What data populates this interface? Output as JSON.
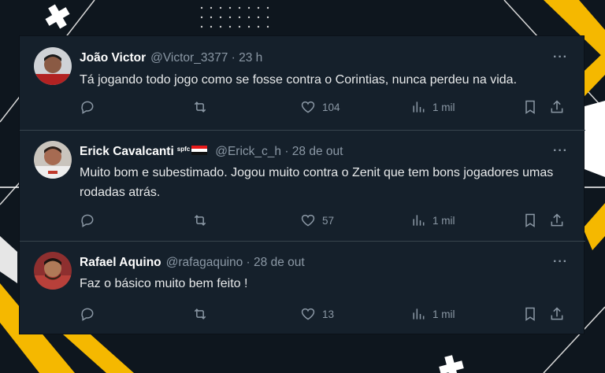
{
  "tweets": [
    {
      "name": "João Victor",
      "handle": "@Victor_3377 · 23 h",
      "badge": "",
      "text": "Tá jogando todo jogo como se fosse contra o Corintias, nunca perdeu na vida.",
      "likes": "104",
      "views": "1 mil"
    },
    {
      "name": "Erick Cavalcanti",
      "handle": "@Erick_c_h · 28 de out",
      "badge": "spfc",
      "text": "Muito bom e subestimado. Jogou muito contra o Zenit que tem bons jogadores umas rodadas atrás.",
      "likes": "57",
      "views": "1 mil"
    },
    {
      "name": "Rafael Aquino",
      "handle": "@rafagaquino · 28 de out",
      "badge": "",
      "text": "Faz o básico muito bem feito !",
      "likes": "13",
      "views": "1 mil"
    }
  ],
  "more_label": "···",
  "colors": {
    "background": "#15202b",
    "text": "#e7e9ea",
    "muted": "#8b98a5",
    "accent_yellow": "#f5b800"
  },
  "icons": [
    "reply-icon",
    "retweet-icon",
    "like-icon",
    "views-icon",
    "bookmark-icon",
    "share-icon",
    "more-icon"
  ]
}
